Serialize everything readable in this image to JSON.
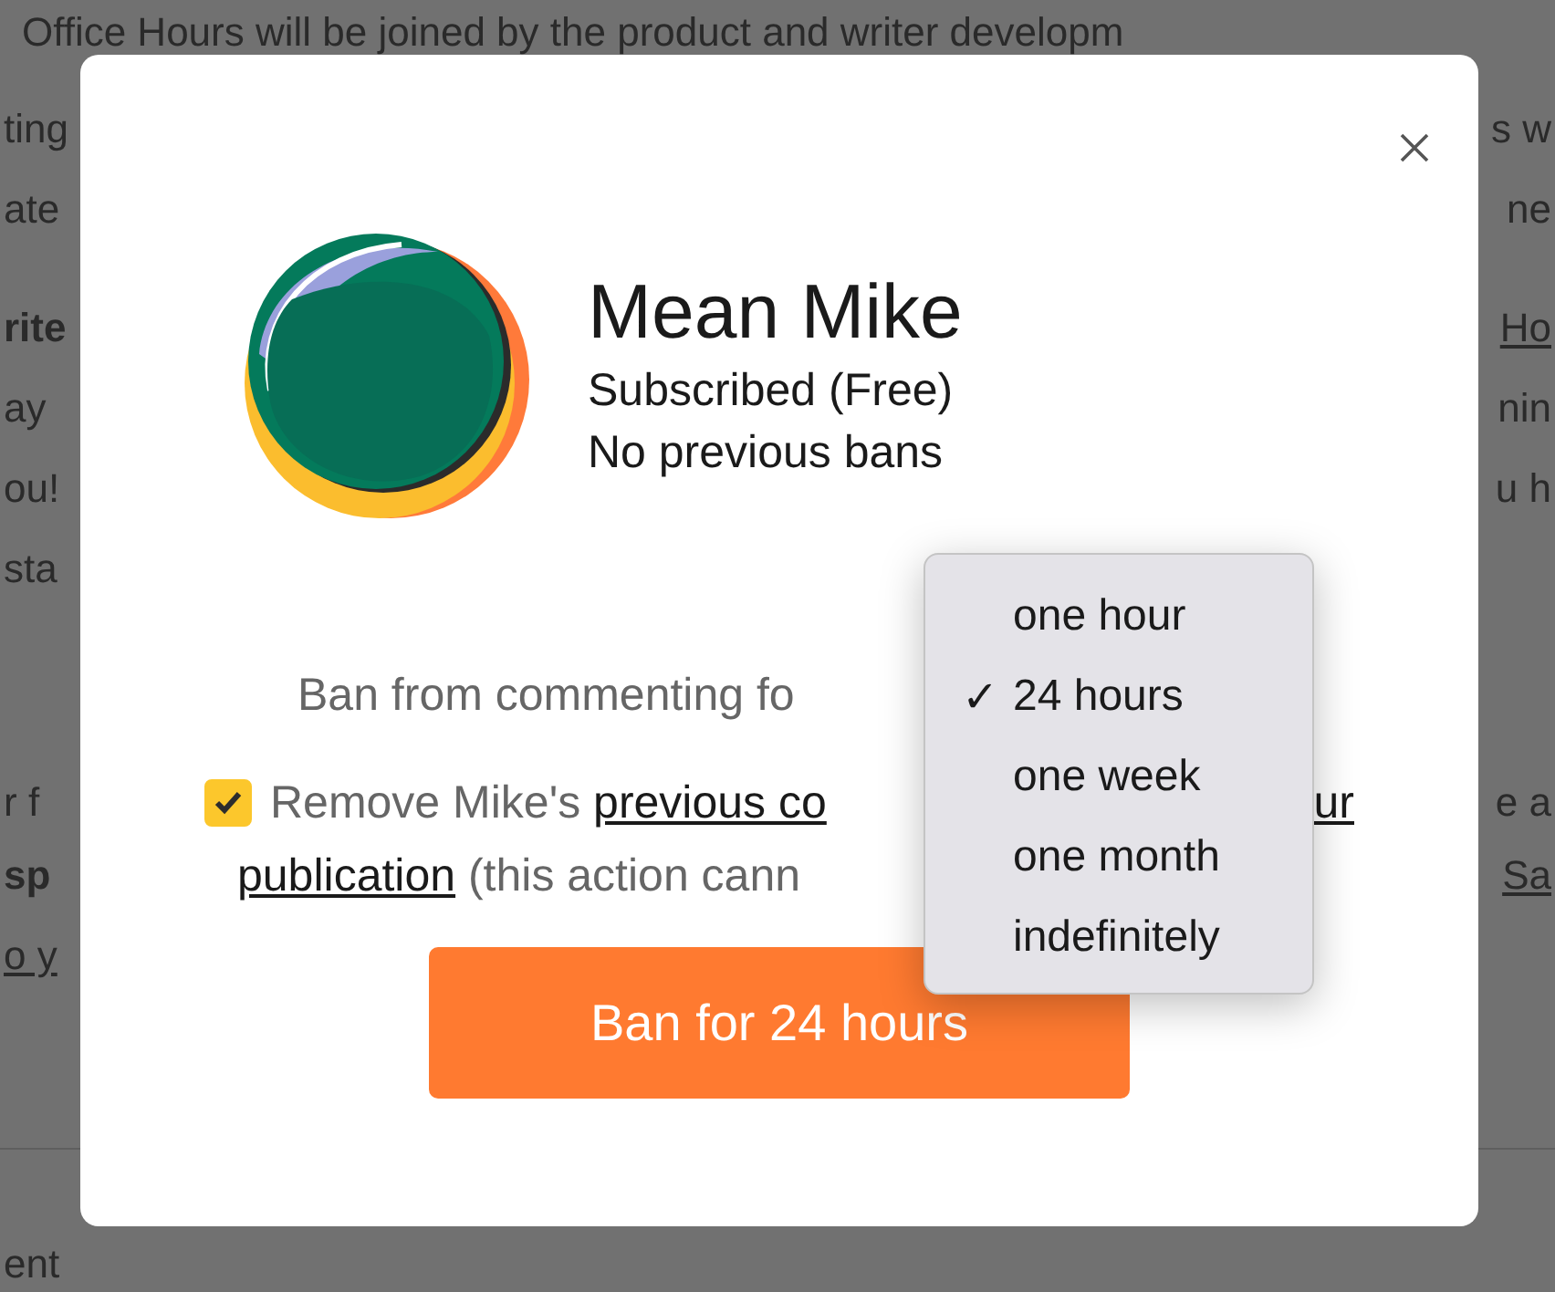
{
  "background": {
    "headline": "Office Hours will be joined by the product and writer developm",
    "paragraphs": [
      [
        {
          "left": {
            "text": "ting",
            "kind": "plain"
          },
          "right": {
            "text": "s w",
            "kind": "plain"
          }
        },
        {
          "left": {
            "text": "ate",
            "kind": "plain"
          },
          "right": {
            "text": "ne",
            "kind": "plain"
          }
        }
      ],
      [
        {
          "left": {
            "text": "rite",
            "kind": "bold"
          },
          "right": {
            "text": "Ho",
            "kind": "link"
          }
        },
        {
          "left": {
            "text": "ay",
            "kind": "plain"
          },
          "right": {
            "text": "nin",
            "kind": "plain"
          }
        },
        {
          "left": {
            "text": "ou!",
            "kind": "plain"
          },
          "right": {
            "text": "u h",
            "kind": "plain"
          }
        },
        {
          "left": {
            "text": "sta",
            "kind": "plain"
          }
        }
      ],
      [
        {
          "left": {
            "text": "r f",
            "kind": "plain"
          },
          "right": {
            "text": "e a",
            "kind": "plain"
          }
        }
      ],
      [
        {
          "left": {
            "text": "sp",
            "kind": "bold"
          },
          "right": {
            "text": "Sa",
            "kind": "link"
          }
        },
        {
          "left": {
            "text": "o y",
            "kind": "link"
          }
        }
      ]
    ],
    "footer": "ent"
  },
  "dialog": {
    "name": "Mean Mike",
    "subscription": "Subscribed (Free)",
    "history": "No previous bans",
    "ban_label": "Ban from commenting fo",
    "remove_comments": {
      "checked": true,
      "prefix": "Remove Mike's ",
      "link_start": "previous co",
      "link_end": "ur",
      "link_line2": "publication",
      "note": " (this action cann"
    },
    "button": "Ban for 24 hours"
  },
  "dropdown": {
    "options": [
      {
        "label": "one hour",
        "selected": false
      },
      {
        "label": "24 hours",
        "selected": true
      },
      {
        "label": "one week",
        "selected": false
      },
      {
        "label": "one month",
        "selected": false
      },
      {
        "label": "indefinitely",
        "selected": false
      }
    ],
    "check": "✓"
  }
}
